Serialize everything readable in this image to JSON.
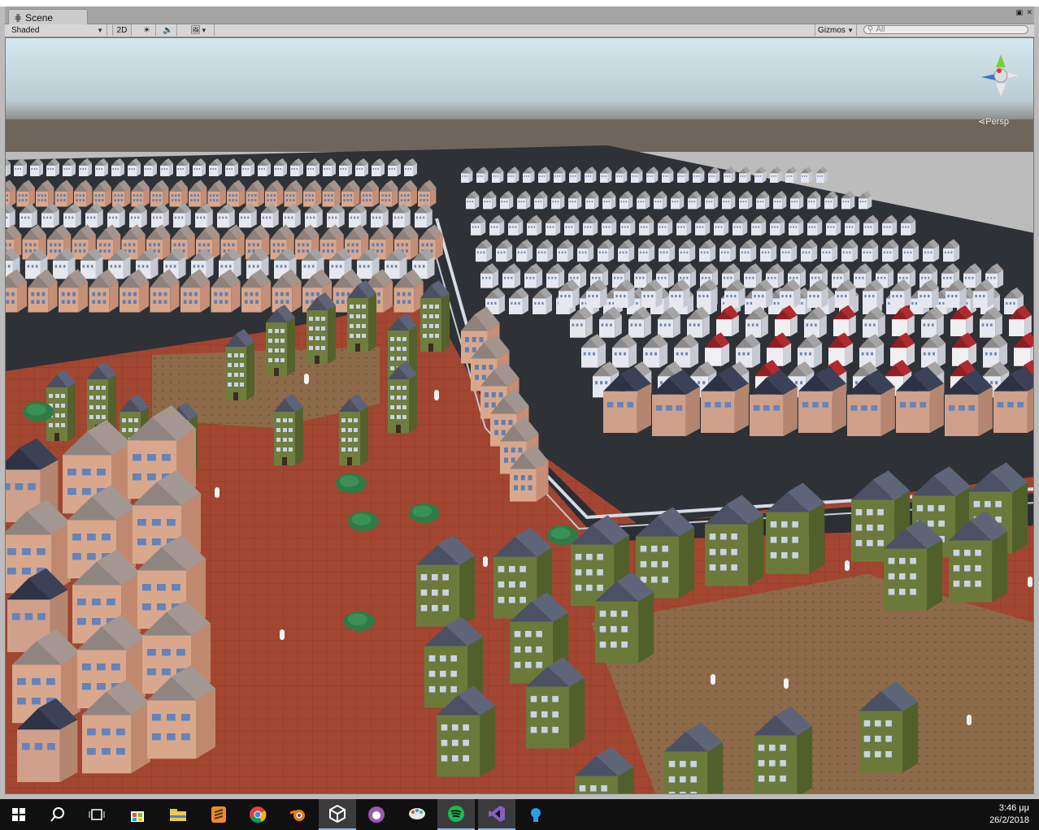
{
  "window": {
    "minimize_icon": "maximize-icon",
    "close_icon": "close-icon"
  },
  "tab": {
    "label": "Scene"
  },
  "toolbar": {
    "draw_mode": "Shaded",
    "mode_2d": "2D",
    "gizmos": "Gizmos",
    "search_placeholder": "All"
  },
  "scene": {
    "projection": "Persp"
  },
  "taskbar": {
    "items": [
      "windows-start",
      "search",
      "task-view",
      "store",
      "file-explorer",
      "sublime-text",
      "chrome",
      "blender",
      "unity",
      "app-purple",
      "paint",
      "spotify",
      "visual-studio",
      "app-blue"
    ],
    "time": "3:46 μμ",
    "date": "26/2/2018"
  },
  "colors": {
    "ground": "#a0452f",
    "road": "#2f3338",
    "sky_top": "#cfe4ea",
    "horizon": "#6f665e",
    "house_wall": "#d9a58a",
    "roof": "#8a7d78",
    "dark_roof": "#373c4a",
    "tower_wall": "#6f7d3e"
  }
}
